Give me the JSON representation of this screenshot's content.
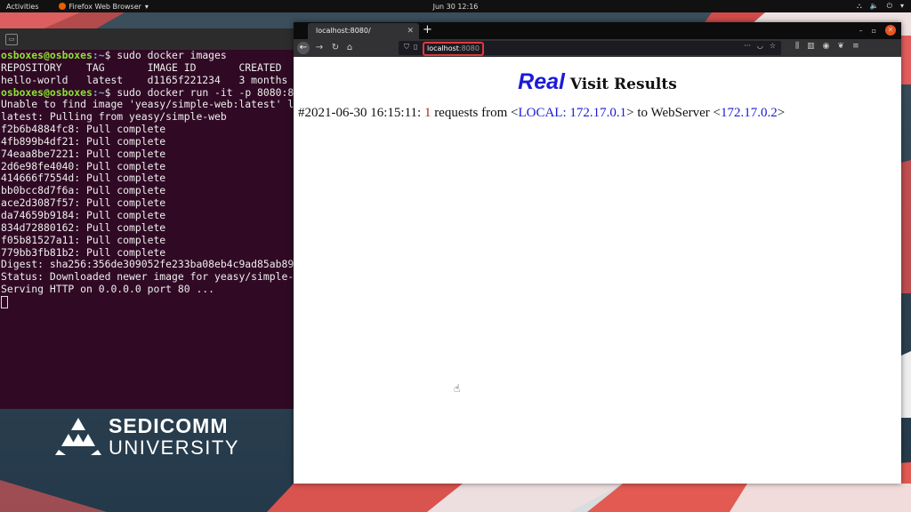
{
  "topbar": {
    "activities": "Activities",
    "app_name": "Firefox Web Browser",
    "clock": "Jun 30  12:16"
  },
  "terminal": {
    "lines": [
      {
        "user": "osboxes@osboxes",
        "path": ":~",
        "cmd": "$ sudo docker images"
      },
      {
        "text": "REPOSITORY    TAG       IMAGE ID       CREATED"
      },
      {
        "text": "hello-world   latest    d1165f221234   3 months"
      },
      {
        "user": "osboxes@osboxes",
        "path": ":~",
        "cmd": "$ sudo docker run -it -p 8080:8"
      },
      {
        "text": "Unable to find image 'yeasy/simple-web:latest' l"
      },
      {
        "text": "latest: Pulling from yeasy/simple-web"
      },
      {
        "text": "f2b6b4884fc8: Pull complete"
      },
      {
        "text": "4fb899b4df21: Pull complete"
      },
      {
        "text": "74eaa8be7221: Pull complete"
      },
      {
        "text": "2d6e98fe4040: Pull complete"
      },
      {
        "text": "414666f7554d: Pull complete"
      },
      {
        "text": "bb0bcc8d7f6a: Pull complete"
      },
      {
        "text": "ace2d3087f57: Pull complete"
      },
      {
        "text": "da74659b9184: Pull complete"
      },
      {
        "text": "834d72880162: Pull complete"
      },
      {
        "text": "f05b81527a11: Pull complete"
      },
      {
        "text": "779bb3fb81b2: Pull complete"
      },
      {
        "text": "Digest: sha256:356de309052fe233ba08eb4c9ad85ab89"
      },
      {
        "text": "Status: Downloaded newer image for yeasy/simple-"
      },
      {
        "text": "Serving HTTP on 0.0.0.0 port 80 ..."
      }
    ]
  },
  "logo": {
    "line1": "SEDICOMM",
    "line2": "UNIVERSITY"
  },
  "firefox": {
    "tab_label": "localhost:8080/",
    "url_host": "localhost",
    "url_port": ":8080",
    "page": {
      "title_emph": "Real",
      "title_rest": " Visit Results",
      "visit": {
        "prefix": "#2021-06-30 16:15:11: ",
        "count": "1",
        "mid1": " requests from <",
        "local": "LOCAL: 172.17.0.1",
        "mid2": "> to WebServer <",
        "server": "172.17.0.2",
        "suffix": ">"
      }
    }
  },
  "colors": {
    "terminal_bg": "#300a24",
    "prompt_user": "#8ae234",
    "prompt_path": "#729fcf",
    "link_blue": "#1a1ad9",
    "count_red": "#b22222",
    "ubuntu_orange": "#e95420"
  }
}
